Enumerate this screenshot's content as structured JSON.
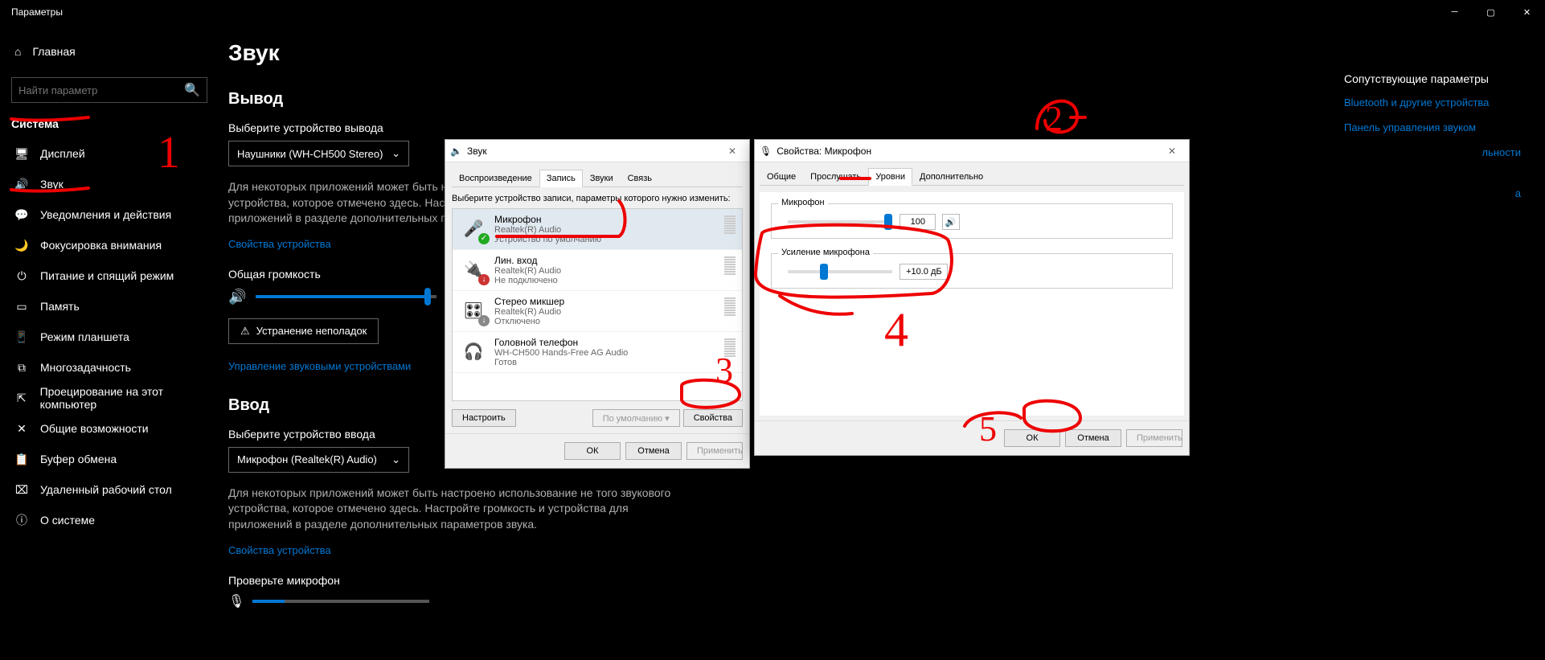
{
  "window": {
    "title": "Параметры"
  },
  "sidebar": {
    "home": "Главная",
    "search_placeholder": "Найти параметр",
    "category": "Система",
    "items": [
      {
        "icon": "🖥",
        "label": "Дисплей"
      },
      {
        "icon": "🔊",
        "label": "Звук"
      },
      {
        "icon": "💬",
        "label": "Уведомления и действия"
      },
      {
        "icon": "🌙",
        "label": "Фокусировка внимания"
      },
      {
        "icon": "⏻",
        "label": "Питание и спящий режим"
      },
      {
        "icon": "▭",
        "label": "Память"
      },
      {
        "icon": "📱",
        "label": "Режим планшета"
      },
      {
        "icon": "⧉",
        "label": "Многозадачность"
      },
      {
        "icon": "⇱",
        "label": "Проецирование на этот компьютер"
      },
      {
        "icon": "✕",
        "label": "Общие возможности"
      },
      {
        "icon": "📋",
        "label": "Буфер обмена"
      },
      {
        "icon": "⌧",
        "label": "Удаленный рабочий стол"
      },
      {
        "icon": "ⓘ",
        "label": "О системе"
      }
    ]
  },
  "page": {
    "title": "Звук",
    "output": {
      "heading": "Вывод",
      "select_label": "Выберите устройство вывода",
      "device": "Наушники (WH-CH500 Stereo)",
      "desc": "Для некоторых приложений может быть настроено использование не того звукового устройства, которое отмечено здесь. Настройте громкость и устройства для приложений в разделе дополнительных параметров звука.",
      "props_link": "Свойства устройства",
      "volume_label": "Общая громкость",
      "volume_percent": 95,
      "troubleshoot": "Устранение неполадок",
      "manage_link": "Управление звуковыми устройствами"
    },
    "input": {
      "heading": "Ввод",
      "select_label": "Выберите устройство ввода",
      "device": "Микрофон (Realtek(R) Audio)",
      "desc": "Для некоторых приложений может быть настроено использование не того звукового устройства, которое отмечено здесь. Настройте громкость и устройства для приложений в разделе дополнительных параметров звука.",
      "props_link": "Свойства устройства",
      "test_label": "Проверьте микрофон"
    }
  },
  "right": {
    "heading": "Сопутствующие параметры",
    "links": [
      "Bluetooth и другие устройства",
      "Панель управления звуком",
      "льности",
      "а"
    ]
  },
  "sound_dlg": {
    "title": "Звук",
    "tabs": [
      "Воспроизведение",
      "Запись",
      "Звуки",
      "Связь"
    ],
    "active_tab": 1,
    "instruction": "Выберите устройство записи, параметры которого нужно изменить:",
    "devices": [
      {
        "name": "Микрофон",
        "sub1": "Realtek(R) Audio",
        "sub2": "Устройство по умолчанию",
        "status": "default",
        "icon": "🎤"
      },
      {
        "name": "Лин. вход",
        "sub1": "Realtek(R) Audio",
        "sub2": "Не подключено",
        "status": "disconnected",
        "icon": "🔌"
      },
      {
        "name": "Стерео микшер",
        "sub1": "Realtek(R) Audio",
        "sub2": "Отключено",
        "status": "disabled",
        "icon": "🎛"
      },
      {
        "name": "Головной телефон",
        "sub1": "WH-CH500 Hands-Free AG Audio",
        "sub2": "Готов",
        "status": "ready",
        "icon": "🎧"
      }
    ],
    "configure": "Настроить",
    "default_btn": "По умолчанию",
    "properties": "Свойства",
    "ok": "ОК",
    "cancel": "Отмена",
    "apply": "Применить"
  },
  "props_dlg": {
    "title": "Свойства: Микрофон",
    "tabs": [
      "Общие",
      "Прослушать",
      "Уровни",
      "Дополнительно"
    ],
    "active_tab": 2,
    "mic_group": "Микрофон",
    "mic_level": 100,
    "boost_group": "Усиление микрофона",
    "boost_value": "+10.0 дБ",
    "boost_percent": 33,
    "ok": "ОК",
    "cancel": "Отмена",
    "apply": "Применить"
  },
  "annotations": [
    "1",
    "2",
    "3",
    "4",
    "5"
  ]
}
